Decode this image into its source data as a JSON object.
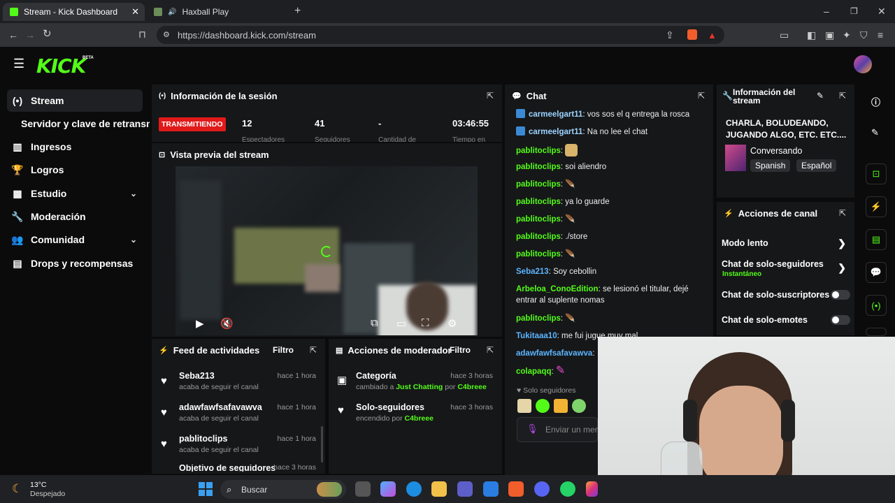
{
  "browser": {
    "tabs": [
      {
        "title": "Stream - Kick Dashboard"
      },
      {
        "title": "Haxball Play"
      }
    ],
    "url": "https://dashboard.kick.com/stream"
  },
  "sidebar": {
    "items": [
      {
        "label": "Stream"
      },
      {
        "label": "Servidor y clave de retransm"
      },
      {
        "label": "Ingresos"
      },
      {
        "label": "Logros"
      },
      {
        "label": "Estudio"
      },
      {
        "label": "Moderación"
      },
      {
        "label": "Comunidad"
      },
      {
        "label": "Drops y recompensas"
      }
    ],
    "beta": "BETA",
    "logo": "KICK"
  },
  "session": {
    "title": "Información de la sesión",
    "status": "TRANSMITIENDO",
    "stats": [
      {
        "value": "12",
        "label": "Espectadores"
      },
      {
        "value": "41",
        "label": "Seguidores"
      },
      {
        "value": "-",
        "label": "Cantidad de"
      },
      {
        "value": "03:46:55",
        "label": "Tiempo en"
      }
    ]
  },
  "preview": {
    "title": "Vista previa del stream"
  },
  "feed": {
    "title": "Feed de actividades",
    "filter": "Filtro",
    "items": [
      {
        "name": "Seba213",
        "sub": "acaba de seguir el canal",
        "time": "hace 1 hora"
      },
      {
        "name": "adawfawfsafavawva",
        "sub": "acaba de seguir el canal",
        "time": "hace 1 hora"
      },
      {
        "name": "pablitoclips",
        "sub": "acaba de seguir el canal",
        "time": "hace 1 hora"
      },
      {
        "name": "Objetivo de seguidores",
        "sub": "",
        "time": "hace 3 horas"
      }
    ]
  },
  "modactions": {
    "title": "Acciones de moderador",
    "filter": "Filtro",
    "items": [
      {
        "name": "Categoría",
        "sub_pre": "cambiado a",
        "sub_hl": "Just Chatting",
        "sub_by": "por",
        "sub_user": "C4breee",
        "time": "hace 3 horas"
      },
      {
        "name": "Solo-seguidores",
        "sub_pre": "encendido",
        "sub_by": "por",
        "sub_user": "C4breee",
        "time": "hace 3 horas"
      }
    ]
  },
  "chat": {
    "title": "Chat",
    "messages": [
      {
        "user": "carmeelgart11",
        "text": ": vos sos el q entrega la rosca"
      },
      {
        "user": "carmeelgart11",
        "text": ": Na no lee el chat"
      },
      {
        "user": "pablitoclips",
        "text": ":"
      },
      {
        "user": "pablitoclips",
        "text": ": soi aliendro"
      },
      {
        "user": "pablitoclips",
        "text": ":"
      },
      {
        "user": "pablitoclips",
        "text": ": ya lo guarde"
      },
      {
        "user": "pablitoclips",
        "text": ":"
      },
      {
        "user": "pablitoclips",
        "text": ": ./store"
      },
      {
        "user": "pablitoclips",
        "text": ":"
      },
      {
        "user": "Seba213",
        "text": ": Soy cebollin"
      },
      {
        "user": "Arbeloa_ConoEdition",
        "text": ": se lesionó el titular, dejé entrar al suplente nomas"
      },
      {
        "user": "pablitoclips",
        "text": ":"
      },
      {
        "user": "Tukitaaa10",
        "text": ": me fui jugue muy mal"
      },
      {
        "user": "adawfawfsafavawva",
        "text": ":"
      },
      {
        "user": "colapaqq",
        "text": ":"
      }
    ],
    "mode": "Solo seguidores",
    "placeholder": "Enviar un mensaje"
  },
  "streaminfo": {
    "title": "Información del stream",
    "stream_title": "CHARLA, BOLUDEANDO, JUGANDO ALGO, ETC. ETC....",
    "category": "Conversando",
    "tags": [
      "Spanish",
      "Español"
    ]
  },
  "channelactions": {
    "title": "Acciones de canal",
    "items": [
      {
        "label": "Modo lento",
        "sub": ""
      },
      {
        "label": "Chat de solo-seguidores",
        "sub": "Instantáneo"
      },
      {
        "label": "Chat de solo-suscriptores",
        "sub": ""
      },
      {
        "label": "Chat de solo-emotes",
        "sub": ""
      }
    ]
  },
  "taskbar": {
    "temp": "13°C",
    "weather": "Despejado",
    "search": "Buscar"
  },
  "colors": {
    "accent": "#53fc18",
    "live": "#e01a1a",
    "panel": "#161719"
  }
}
